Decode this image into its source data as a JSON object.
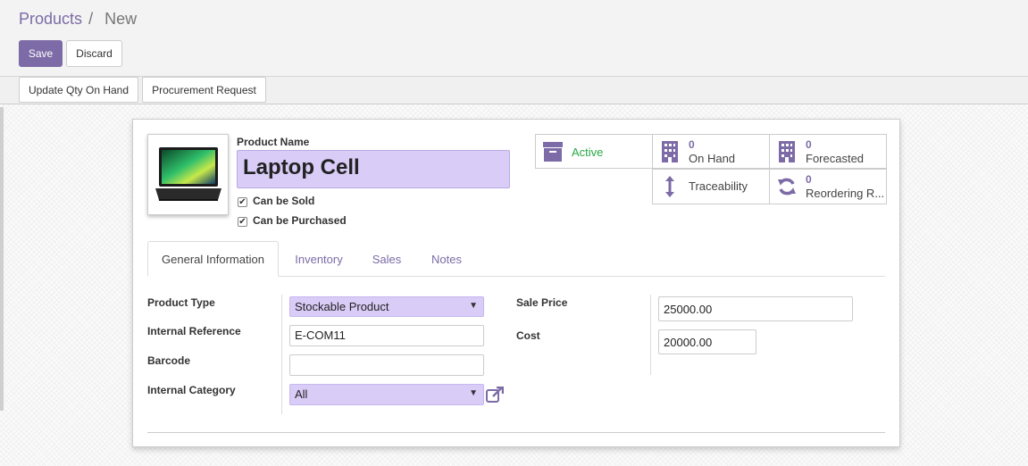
{
  "breadcrumb": {
    "parent": "Products",
    "separator": "/",
    "current": "New"
  },
  "toolbar": {
    "save_label": "Save",
    "discard_label": "Discard"
  },
  "statusbar": {
    "update_qty_label": "Update Qty On Hand",
    "procurement_label": "Procurement Request"
  },
  "product": {
    "name_label": "Product Name",
    "name_value": "Laptop Cell",
    "can_be_sold_label": "Can be Sold",
    "can_be_purchased_label": "Can be Purchased",
    "image_icon": "laptop-image"
  },
  "smart_buttons": {
    "active_label": "Active",
    "on_hand_count": "0",
    "on_hand_label": "On Hand",
    "forecasted_count": "0",
    "forecasted_label": "Forecasted",
    "traceability_label": "Traceability",
    "reordering_count": "0",
    "reordering_label": "Reordering R..."
  },
  "tabs": [
    {
      "label": "General Information"
    },
    {
      "label": "Inventory"
    },
    {
      "label": "Sales"
    },
    {
      "label": "Notes"
    }
  ],
  "general": {
    "product_type_label": "Product Type",
    "product_type_value": "Stockable Product",
    "internal_ref_label": "Internal Reference",
    "internal_ref_value": "E-COM11",
    "barcode_label": "Barcode",
    "barcode_value": "",
    "category_label": "Internal Category",
    "category_value": "All",
    "sale_price_label": "Sale Price",
    "sale_price_value": "25000.00",
    "cost_label": "Cost",
    "cost_value": "20000.00"
  },
  "colors": {
    "primary": "#7c6ba6",
    "required_field": "#d9ccf7",
    "active_text": "#28a745"
  }
}
